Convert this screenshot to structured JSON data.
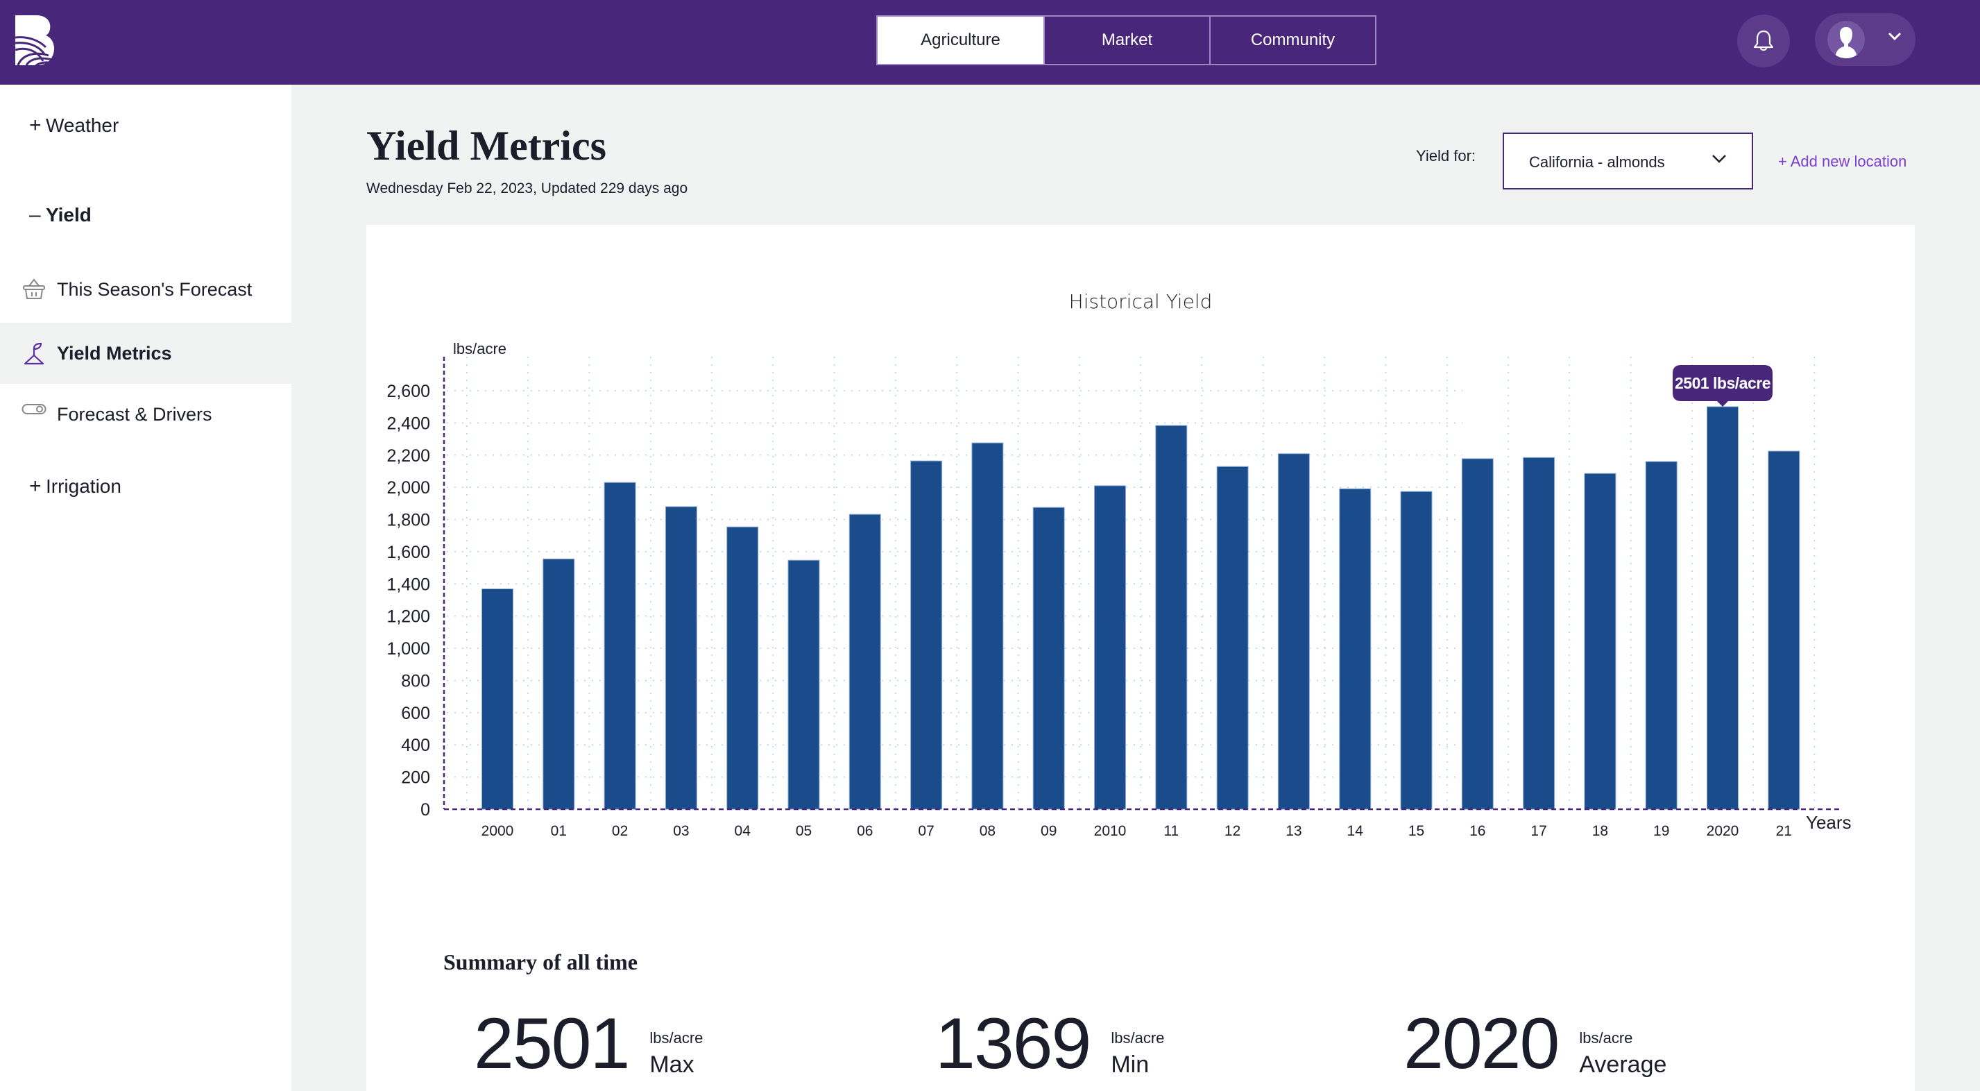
{
  "header": {
    "tabs": [
      {
        "label": "Agriculture",
        "active": true
      },
      {
        "label": "Market",
        "active": false
      },
      {
        "label": "Community",
        "active": false
      }
    ],
    "icons": {
      "bell": "bell-icon",
      "avatar": "user-avatar-icon",
      "menu": "chevron-down-icon"
    }
  },
  "sidebar": {
    "groups": [
      {
        "sign": "+",
        "label": "Weather",
        "expanded": false
      },
      {
        "sign": "–",
        "label": "Yield",
        "expanded": true
      },
      {
        "sign": "+",
        "label": "Irrigation",
        "expanded": false
      }
    ],
    "items": [
      {
        "label": "This Season's Forecast",
        "icon": "basket-icon",
        "active": false
      },
      {
        "label": "Yield Metrics",
        "icon": "sprout-icon",
        "active": true
      },
      {
        "label": "Forecast & Drivers",
        "icon": "toggle-icon",
        "active": false
      }
    ]
  },
  "page": {
    "title": "Yield Metrics",
    "subtitle": "Wednesday Feb 22, 2023, Updated 229 days ago",
    "yield_for_label": "Yield for:",
    "location_value": "California - almonds",
    "add_location": "+ Add new location"
  },
  "colors": {
    "brand": "#48277a",
    "bar": "#1a4b8a",
    "link": "#7a3fd0",
    "grid": "#a9d5f0",
    "axis": "#48277a"
  },
  "chart_data": {
    "type": "bar",
    "title": "Historical Yield",
    "xlabel": "Years",
    "ylabel": "lbs/acre",
    "ylim": [
      0,
      2600
    ],
    "yticks": [
      0,
      200,
      400,
      600,
      800,
      1000,
      1200,
      1400,
      1600,
      1800,
      2000,
      2200,
      2400,
      2600
    ],
    "ytick_labels": [
      "0",
      "200",
      "400",
      "600",
      "800",
      "1,000",
      "1,200",
      "1,400",
      "1,600",
      "1,800",
      "2,000",
      "2,200",
      "2,400",
      "2,600"
    ],
    "categories": [
      "2000",
      "01",
      "02",
      "03",
      "04",
      "05",
      "06",
      "07",
      "08",
      "09",
      "2010",
      "11",
      "12",
      "13",
      "14",
      "15",
      "16",
      "17",
      "18",
      "19",
      "2020",
      "21"
    ],
    "values": [
      1369,
      1555,
      2030,
      1880,
      1754,
      1547,
      1832,
      2164,
      2276,
      1875,
      2010,
      2384,
      2129,
      2209,
      1991,
      1974,
      2178,
      2185,
      2086,
      2160,
      2501,
      2225
    ],
    "grid": true,
    "tooltip": {
      "category": "2020",
      "text": "2501 lbs/acre"
    }
  },
  "summary": {
    "title": "Summary of all time",
    "stats": [
      {
        "value": "2501",
        "unit": "lbs/acre",
        "label": "Max"
      },
      {
        "value": "1369",
        "unit": "lbs/acre",
        "label": "Min"
      },
      {
        "value": "2020",
        "unit": "lbs/acre",
        "label": "Average"
      }
    ]
  }
}
